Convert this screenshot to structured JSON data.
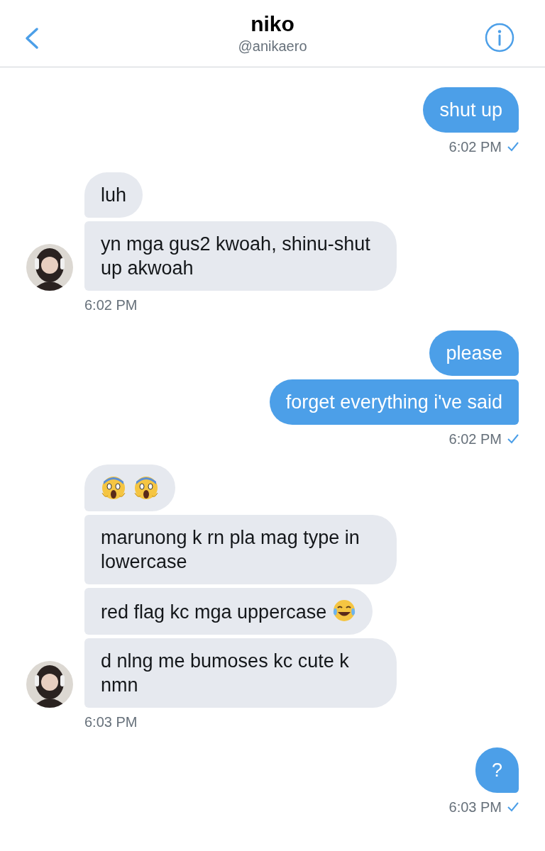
{
  "header": {
    "title": "niko",
    "subtitle": "@anikaero"
  },
  "groups": [
    {
      "kind": "sent",
      "messages": [
        {
          "kind": "text",
          "text": "shut up"
        }
      ],
      "time": "6:02 PM",
      "read": true
    },
    {
      "kind": "received",
      "messages": [
        {
          "kind": "text",
          "text": "luh"
        },
        {
          "kind": "text",
          "text": "yn mga gus2 kwoah, shinu-shut up akwoah"
        }
      ],
      "time": "6:02 PM",
      "read": false
    },
    {
      "kind": "sent",
      "messages": [
        {
          "kind": "text",
          "text": "please"
        },
        {
          "kind": "text",
          "text": "forget everything i've said"
        }
      ],
      "time": "6:02 PM",
      "read": true
    },
    {
      "kind": "received",
      "messages": [
        {
          "kind": "emoji",
          "icons": [
            {
              "kind": "scream"
            },
            {
              "kind": "scream"
            }
          ]
        },
        {
          "kind": "text",
          "text": "marunong k rn pla mag type in lowercase"
        },
        {
          "kind": "text",
          "text": "red flag kc mga uppercase",
          "trailing_icon": {
            "kind": "laughing"
          }
        },
        {
          "kind": "text",
          "text": "d nlng me bumoses kc cute k nmn"
        }
      ],
      "time": "6:03 PM",
      "read": false
    },
    {
      "kind": "sent",
      "messages": [
        {
          "kind": "text",
          "text": "?"
        }
      ],
      "time": "6:03 PM",
      "read": true
    }
  ]
}
